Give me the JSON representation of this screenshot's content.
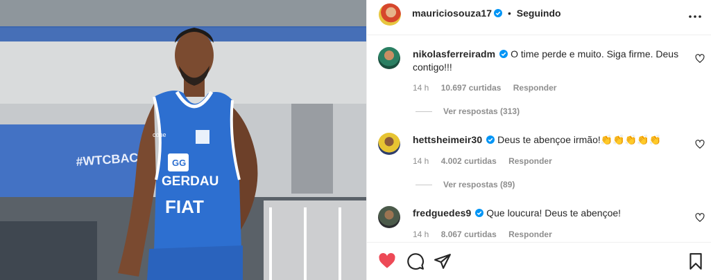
{
  "post": {
    "author": "mauriciosouza17",
    "follow_state": "Seguindo",
    "separator": "•"
  },
  "comments": [
    {
      "username": "nikolasferreiradm",
      "text": "O time perde e muito. Siga firme. Deus contigo!!!",
      "time": "14 h",
      "likes": "10.697 curtidas",
      "reply_label": "Responder",
      "view_replies": "Ver respostas (313)",
      "verified": true
    },
    {
      "username": "hettsheimeir30",
      "text": "Deus te abençoe irmão!👏👏👏👏👏",
      "time": "14 h",
      "likes": "4.002 curtidas",
      "reply_label": "Responder",
      "view_replies": "Ver respostas (89)",
      "verified": true
    },
    {
      "username": "fredguedes9",
      "text": "Que loucura! Deus te abençoe!",
      "time": "14 h",
      "likes": "8.067 curtidas",
      "reply_label": "Responder",
      "verified": true
    }
  ],
  "photo": {
    "jersey_brand_1": "GG",
    "jersey_brand_2": "GERDAU",
    "jersey_brand_3": "FIAT",
    "jersey_maker": "cone",
    "banner_text": "#WTCBACZ"
  },
  "icons": {
    "verified": "verified-badge-icon",
    "more": "more-options-icon",
    "like": "heart-filled-icon",
    "comment": "comment-bubble-icon",
    "share": "paper-plane-icon",
    "save": "bookmark-icon",
    "comment_like": "heart-outline-icon"
  },
  "colors": {
    "like_red": "#ed4956",
    "verified_blue": "#0095f6",
    "muted_text": "#8e8e8e",
    "jersey_blue": "#2d6fd0"
  }
}
